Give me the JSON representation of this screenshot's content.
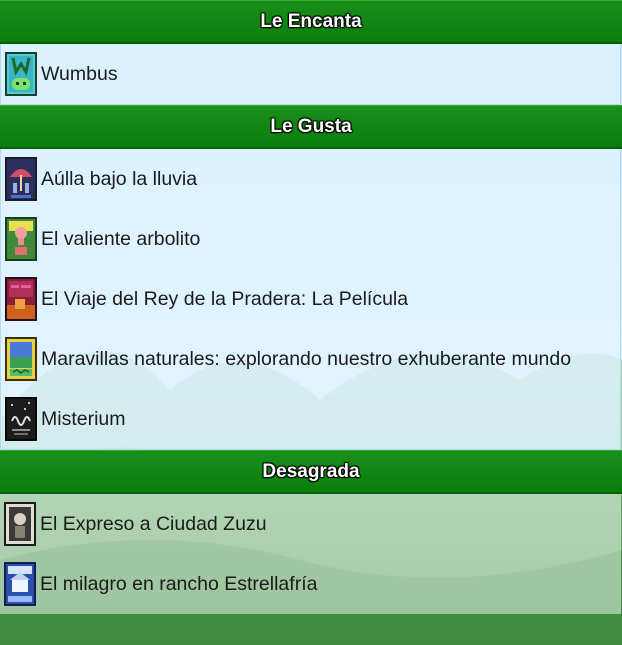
{
  "loves": {
    "title": "Le Encanta",
    "items": [
      {
        "label": "Wumbus",
        "icon": "wumbus-cover-icon"
      }
    ]
  },
  "likes": {
    "title": "Le Gusta",
    "items": [
      {
        "label": "Aúlla bajo la lluvia",
        "icon": "umbrella-cover-icon"
      },
      {
        "label": "El valiente arbolito",
        "icon": "little-tree-cover-icon"
      },
      {
        "label": "El Viaje del Rey de la Pradera: La Película",
        "icon": "prairie-king-cover-icon"
      },
      {
        "label": "Maravillas naturales: explorando nuestro exhuberante mundo",
        "icon": "natural-wonders-cover-icon"
      },
      {
        "label": "Misterium",
        "icon": "misterium-cover-icon"
      }
    ]
  },
  "dislikes": {
    "title": "Desagrada",
    "items": [
      {
        "label": "El Expreso a Ciudad Zuzu",
        "icon": "zuzu-express-cover-icon"
      },
      {
        "label": "El milagro en rancho Estrellafría",
        "icon": "frost-ranch-cover-icon"
      }
    ]
  },
  "colors": {
    "header_green": "#0b7d0b",
    "row_bg": "#e1f3ff",
    "text": "#1b1b1b"
  }
}
